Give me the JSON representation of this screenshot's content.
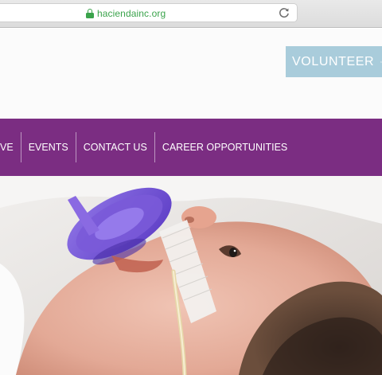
{
  "browser": {
    "url": "haciendainc.org"
  },
  "header": {
    "volunteer_label": "VOLUNTEER"
  },
  "nav": {
    "items": [
      {
        "label": "VE"
      },
      {
        "label": "EVENTS"
      },
      {
        "label": "CONTACT US"
      },
      {
        "label": "CAREER OPPORTUNITIES"
      }
    ]
  },
  "colors": {
    "nav_background": "#7b2d82",
    "volunteer_button": "#a9ccdb",
    "secure_url": "#3aa34b"
  },
  "icons": {
    "lock": "lock-icon",
    "reload": "reload-icon",
    "volunteer": "people-icon"
  }
}
